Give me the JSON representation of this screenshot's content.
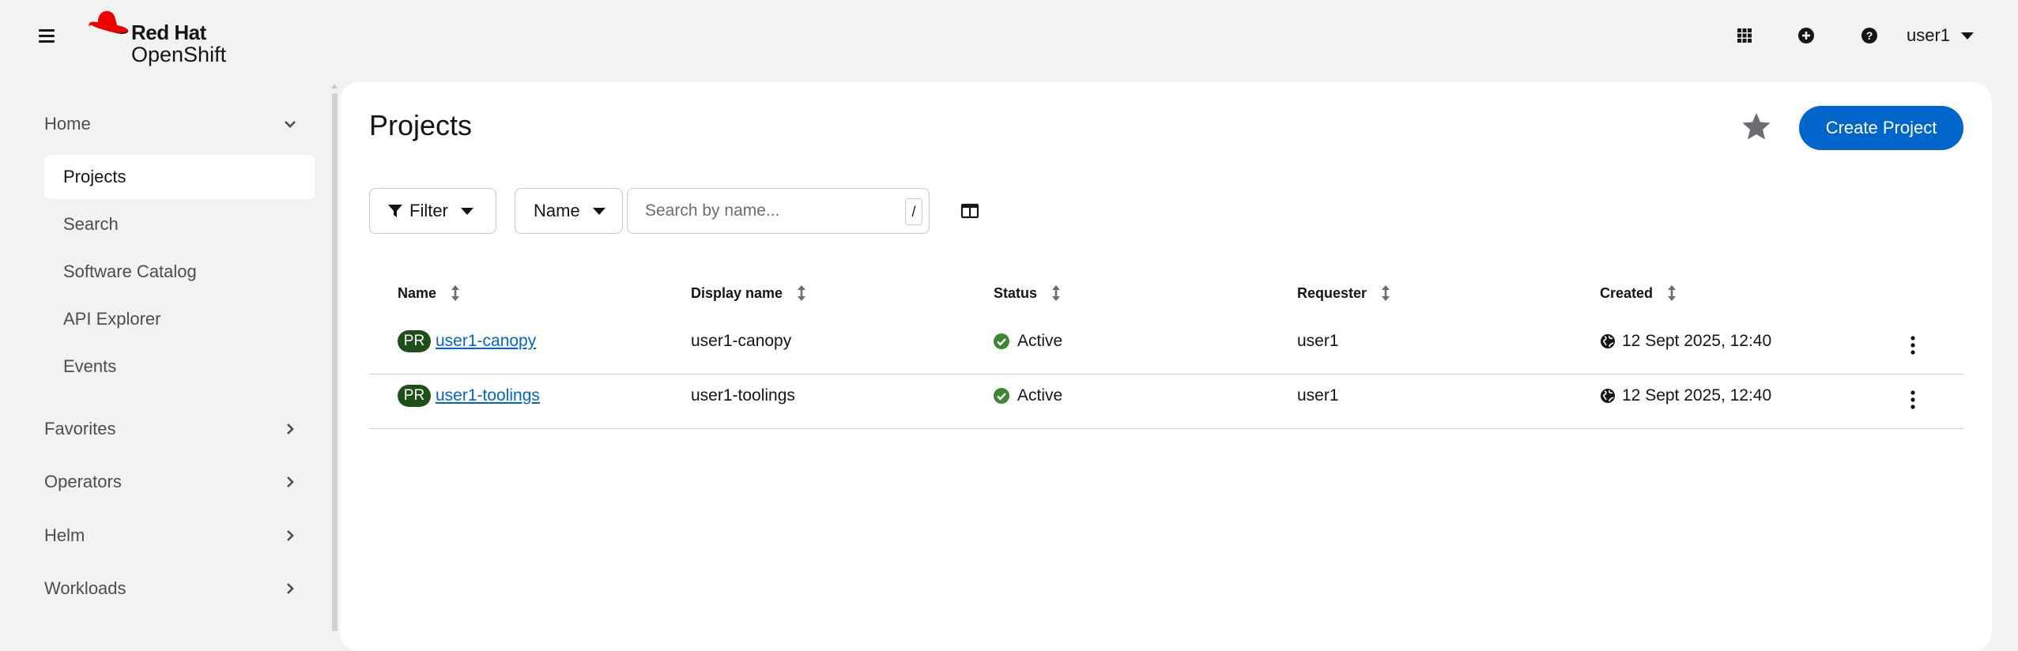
{
  "masthead": {
    "brand_line1": "Red Hat",
    "brand_line2": "OpenShift",
    "user_label": "user1",
    "icons": [
      "hamburger-icon",
      "app-launcher-icon",
      "plus-circle-icon",
      "help-icon"
    ]
  },
  "sidebar": {
    "sections": [
      {
        "label": "Home",
        "expanded": true
      },
      {
        "label": "Favorites",
        "expanded": false
      },
      {
        "label": "Operators",
        "expanded": false
      },
      {
        "label": "Helm",
        "expanded": false
      },
      {
        "label": "Workloads",
        "expanded": false
      }
    ],
    "home_items": [
      {
        "label": "Projects",
        "active": true
      },
      {
        "label": "Search",
        "active": false
      },
      {
        "label": "Software Catalog",
        "active": false
      },
      {
        "label": "API Explorer",
        "active": false
      },
      {
        "label": "Events",
        "active": false
      }
    ]
  },
  "page": {
    "title": "Projects",
    "create_button": "Create Project",
    "filter_label": "Filter",
    "name_dropdown": "Name",
    "search_placeholder": "Search by name...",
    "search_shortcut": "/"
  },
  "table": {
    "columns": [
      "Name",
      "Display name",
      "Status",
      "Requester",
      "Created"
    ],
    "rows": [
      {
        "badge": "PR",
        "name": "user1-canopy",
        "display_name": "user1-canopy",
        "status": "Active",
        "requester": "user1",
        "created": "12 Sept 2025, 12:40"
      },
      {
        "badge": "PR",
        "name": "user1-toolings",
        "display_name": "user1-toolings",
        "status": "Active",
        "requester": "user1",
        "created": "12 Sept 2025, 12:40"
      }
    ]
  },
  "colors": {
    "brand_red": "#ee0000",
    "primary_blue": "#0066cc",
    "badge_green": "#1e4f18",
    "status_green": "#3e8635"
  }
}
